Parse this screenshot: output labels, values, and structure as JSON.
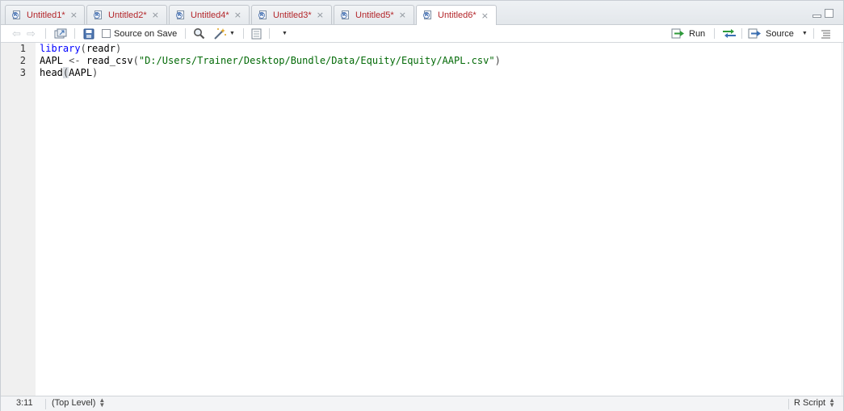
{
  "tabs": [
    {
      "label": "Untitled1*",
      "close": "×"
    },
    {
      "label": "Untitled2*",
      "close": "×"
    },
    {
      "label": "Untitled4*",
      "close": "×"
    },
    {
      "label": "Untitled3*",
      "close": "×"
    },
    {
      "label": "Untitled5*",
      "close": "×"
    },
    {
      "label": "Untitled6*",
      "close": "×"
    }
  ],
  "active_tab": "Untitled6*",
  "toolbar": {
    "source_on_save_label": "Source on Save",
    "run_label": "Run",
    "source_label": "Source"
  },
  "editor": {
    "line_numbers": [
      "1",
      "2",
      "3"
    ],
    "lines": {
      "l1_fn": "library",
      "l1_arg": "readr",
      "l2_var": "AAPL",
      "l2_assign": "<-",
      "l2_fn": "read_csv",
      "l2_str": "\"D:/Users/Trainer/Desktop/Bundle/Data/Equity/Equity/AAPL.csv\"",
      "l3_fn": "head",
      "l3_arg": "AAPL"
    }
  },
  "status": {
    "position": "3:11",
    "scope": "(Top Level)",
    "file_type": "R Script"
  },
  "colors": {
    "tab_text": "#b3262a",
    "keyword": "#0000ff",
    "string": "#036a07"
  }
}
